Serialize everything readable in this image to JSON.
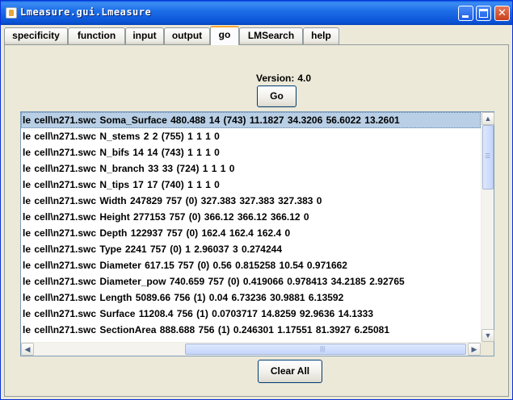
{
  "window": {
    "title": "Lmeasure.gui.Lmeasure",
    "minimize_glyph": "",
    "maximize_glyph": "",
    "close_glyph": "✕"
  },
  "tabs": [
    {
      "label": "specificity",
      "active": false
    },
    {
      "label": "function",
      "active": false
    },
    {
      "label": "input",
      "active": false
    },
    {
      "label": "output",
      "active": false
    },
    {
      "label": "go",
      "active": true
    },
    {
      "label": "LMSearch",
      "active": false
    },
    {
      "label": "help",
      "active": false
    }
  ],
  "go_panel": {
    "version_label": "Version:",
    "version_value": "4.0",
    "go_button": "Go",
    "clear_button": "Clear All",
    "results": [
      "le cell\\n271.swc  Soma_Surface  480.488  14  (743)  11.1827  34.3206  56.6022  13.2601",
      "le cell\\n271.swc  N_stems  2  2  (755)  1  1  1  0",
      "le cell\\n271.swc  N_bifs  14  14  (743)  1  1  1  0",
      "le cell\\n271.swc  N_branch  33  33  (724)  1  1  1  0",
      "le cell\\n271.swc  N_tips  17  17  (740)  1  1  1  0",
      "le cell\\n271.swc  Width  247829  757  (0)  327.383  327.383  327.383  0",
      "le cell\\n271.swc  Height  277153  757  (0)  366.12  366.12  366.12  0",
      "le cell\\n271.swc  Depth  122937  757  (0)  162.4  162.4  162.4  0",
      "le cell\\n271.swc  Type  2241  757  (0)  1  2.96037  3  0.274244",
      "le cell\\n271.swc  Diameter  617.15  757  (0)  0.56  0.815258  10.54  0.971662",
      "le cell\\n271.swc  Diameter_pow  740.659  757  (0)  0.419066  0.978413  34.2185  2.92765",
      "le cell\\n271.swc  Length  5089.66  756  (1)  0.04  6.73236  30.9881  6.13592",
      "le cell\\n271.swc  Surface  11208.4  756  (1)  0.0703717  14.8259  92.9636  14.1333",
      "le cell\\n271.swc  SectionArea  888.688  756  (1)  0.246301  1.17551  81.3927  6.25081"
    ],
    "selected_index": 0
  },
  "colors": {
    "titlebar": "#0a53d6",
    "selection": "#b8cfe5",
    "active_tab_accent": "#f6a72b"
  }
}
